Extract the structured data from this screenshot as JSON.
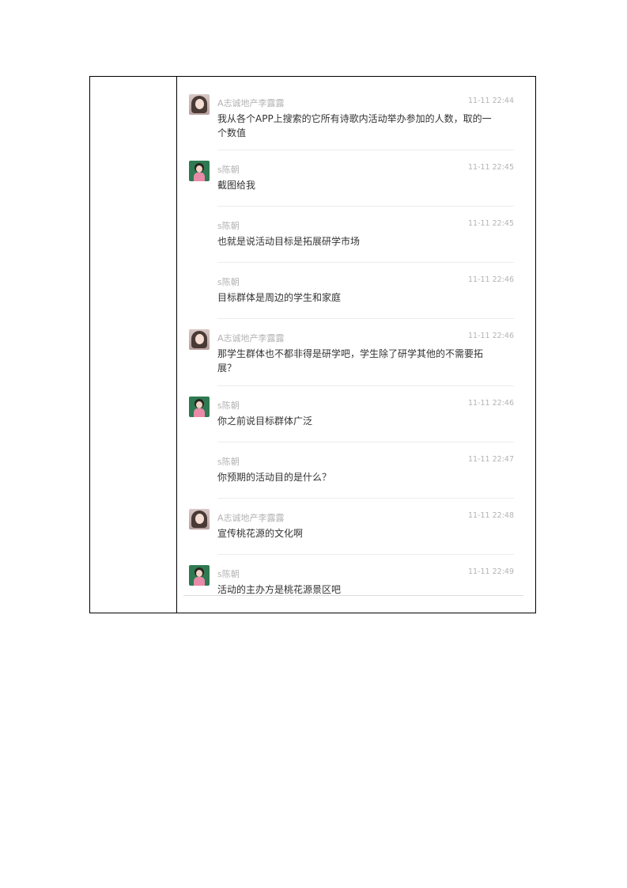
{
  "messages": [
    {
      "sender": "A志诚地产李露露",
      "time": "11-11 22:44",
      "text": "我从各个APP上搜索的它所有诗歌内活动举办参加的人数，取的一个数值",
      "avatar": "woman-icon"
    },
    {
      "sender": "s陈朝",
      "time": "11-11 22:45",
      "text": "截图给我",
      "avatar": "girl-icon"
    },
    {
      "sender": "s陈朝",
      "time": "11-11 22:45",
      "text": "也就是说活动目标是拓展研学市场",
      "avatar": ""
    },
    {
      "sender": "s陈朝",
      "time": "11-11 22:46",
      "text": "目标群体是周边的学生和家庭",
      "avatar": ""
    },
    {
      "sender": "A志诚地产李露露",
      "time": "11-11 22:46",
      "text": "那学生群体也不都非得是研学吧，学生除了研学其他的不需要拓展？",
      "avatar": "woman-icon"
    },
    {
      "sender": "s陈朝",
      "time": "11-11 22:46",
      "text": "你之前说目标群体广泛",
      "avatar": "girl-icon"
    },
    {
      "sender": "s陈朝",
      "time": "11-11 22:47",
      "text": "你预期的活动目的是什么？",
      "avatar": ""
    },
    {
      "sender": "A志诚地产李露露",
      "time": "11-11 22:48",
      "text": "宣传桃花源的文化啊",
      "avatar": "woman-icon"
    },
    {
      "sender": "s陈朝",
      "time": "11-11 22:49",
      "text": "活动的主办方是桃花源景区吧",
      "avatar": "girl-icon"
    }
  ]
}
